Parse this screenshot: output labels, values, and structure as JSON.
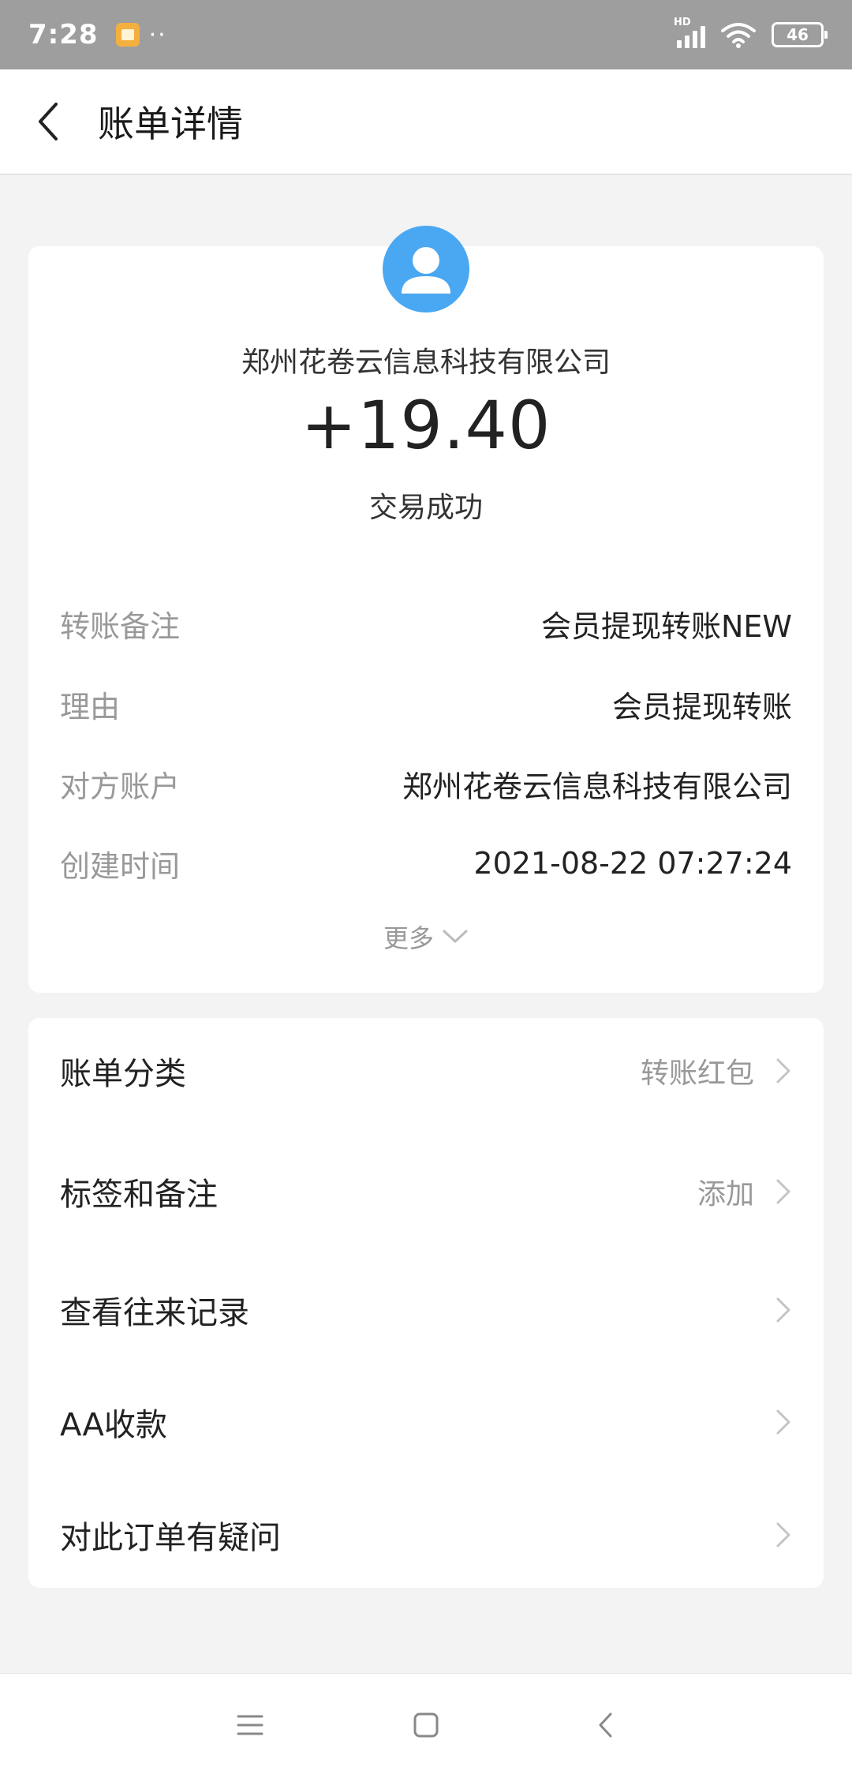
{
  "status_bar": {
    "time": "7:28",
    "dots": "··",
    "network_label": "HD",
    "battery": "46"
  },
  "header": {
    "title": "账单详情"
  },
  "transaction": {
    "counterparty": "郑州花卷云信息科技有限公司",
    "amount": "+19.40",
    "status": "交易成功",
    "details": [
      {
        "label": "转账备注",
        "value": "会员提现转账NEW"
      },
      {
        "label": "理由",
        "value": "会员提现转账"
      },
      {
        "label": "对方账户",
        "value": "郑州花卷云信息科技有限公司"
      },
      {
        "label": "创建时间",
        "value": "2021-08-22 07:27:24"
      }
    ],
    "more_label": "更多"
  },
  "menu": {
    "items": [
      {
        "label": "账单分类",
        "value": "转账红包"
      },
      {
        "label": "标签和备注",
        "value": "添加"
      },
      {
        "label": "查看往来记录",
        "value": ""
      },
      {
        "label": "AA收款",
        "value": ""
      },
      {
        "label": "对此订单有疑问",
        "value": ""
      }
    ]
  },
  "colors": {
    "avatar_blue": "#4aa8f2",
    "status_bar_gray": "#9e9e9e",
    "label_gray": "#999999"
  }
}
